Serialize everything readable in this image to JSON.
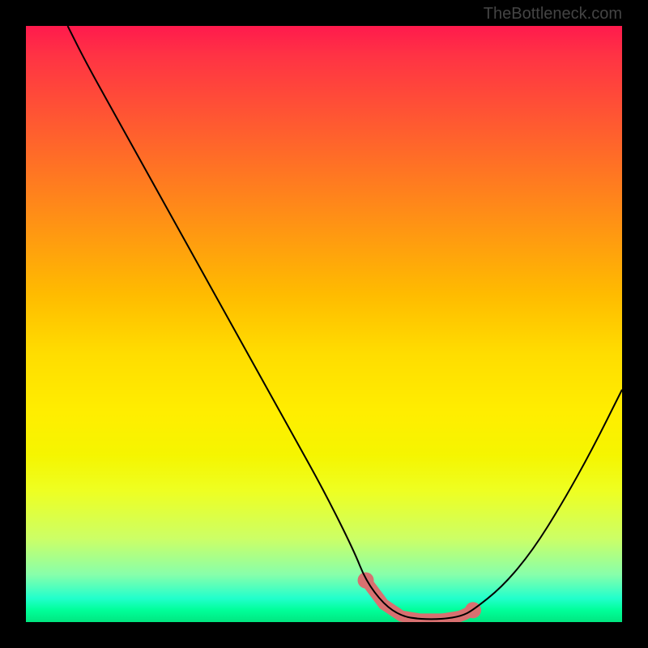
{
  "watermark": "TheBottleneck.com",
  "colors": {
    "curve": "#000000",
    "highlight": "#d87070",
    "bg_black": "#000000"
  },
  "chart_data": {
    "type": "line",
    "title": "",
    "xlabel": "",
    "ylabel": "",
    "xlim": [
      0,
      100
    ],
    "ylim": [
      0,
      100
    ],
    "x": [
      7,
      10,
      15,
      20,
      25,
      30,
      35,
      40,
      45,
      50,
      55,
      57,
      60,
      63,
      66,
      70,
      73,
      75,
      80,
      85,
      90,
      95,
      100
    ],
    "values": [
      100,
      94,
      85,
      76,
      67,
      58,
      49,
      40,
      31,
      22,
      12,
      7,
      3,
      1,
      0.5,
      0.5,
      1,
      2,
      6,
      12,
      20,
      29,
      39
    ],
    "highlight_x_range": [
      57,
      75
    ],
    "note": "Bottleneck curve with steep descending left branch and rising right branch; flat optimal zone highlighted in salmon around x 57–75 near y≈0."
  }
}
